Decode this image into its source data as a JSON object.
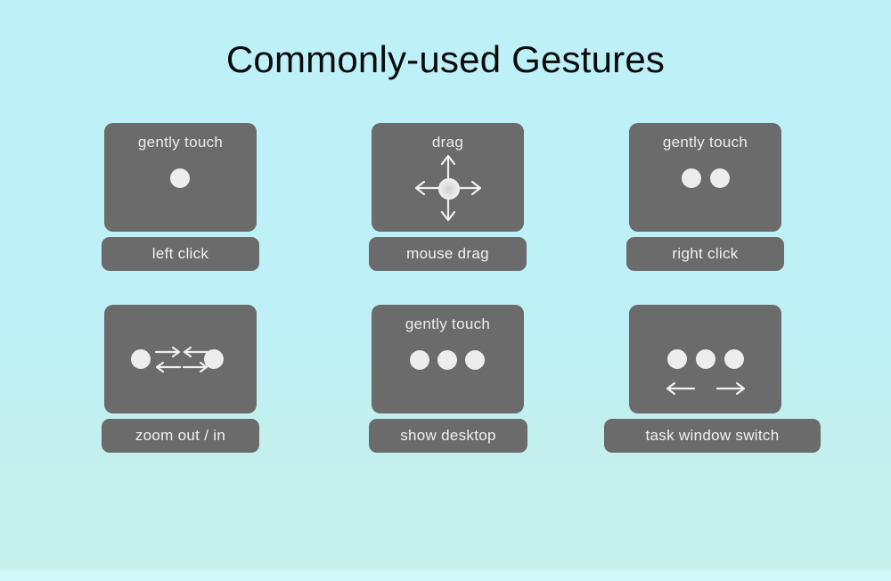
{
  "poster": {
    "title": "Commonly-used Gestures",
    "background_top_color": "#bdf0f7",
    "background_bottom_color": "#c7f2ec",
    "card_color": "#6b6b6b",
    "dot_color": "#ededed",
    "text_color": "#ececec"
  },
  "gestures": [
    {
      "caption": "gently touch",
      "label": "left click",
      "dots": 1,
      "icon": "one-finger-tap-icon"
    },
    {
      "caption": "drag",
      "label": "mouse drag",
      "dots": 1,
      "icon": "four-way-drag-arrows-icon"
    },
    {
      "caption": "gently touch",
      "label": "right click",
      "dots": 2,
      "icon": "two-finger-tap-icon"
    },
    {
      "caption": "",
      "label": "zoom out / in",
      "dots": 2,
      "icon": "pinch-zoom-arrows-icon"
    },
    {
      "caption": "gently touch",
      "label": "show desktop",
      "dots": 3,
      "icon": "three-finger-tap-icon"
    },
    {
      "caption": "",
      "label": "task window switch",
      "dots": 3,
      "icon": "three-finger-swipe-arrows-icon"
    }
  ]
}
